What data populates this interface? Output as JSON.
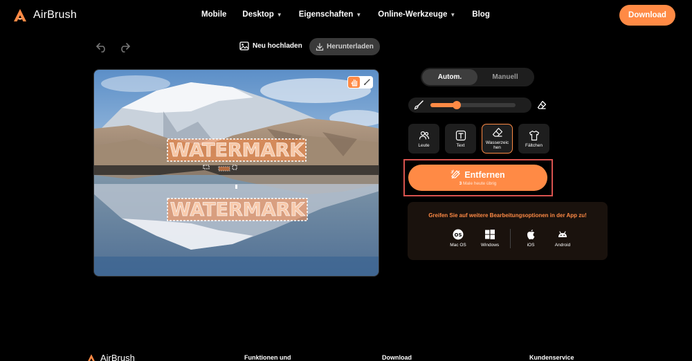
{
  "brand": {
    "name": "AirBrush",
    "accent": "#ff8a45"
  },
  "nav": {
    "items": [
      {
        "label": "Mobile",
        "dropdown": false
      },
      {
        "label": "Desktop",
        "dropdown": true
      },
      {
        "label": "Eigenschaften",
        "dropdown": true
      },
      {
        "label": "Online-Werkzeuge",
        "dropdown": true
      },
      {
        "label": "Blog",
        "dropdown": false
      }
    ],
    "download_label": "Download"
  },
  "toolbar": {
    "upload_label": "Neu hochladen",
    "export_label": "Herunterladen",
    "undo_icon": "undo-icon",
    "redo_icon": "redo-icon"
  },
  "canvas": {
    "watermark_top": "WATERMARK",
    "watermark_bottom": "WATERMARK",
    "active_tool": "hand-icon"
  },
  "panel": {
    "modes": [
      "Autom.",
      "Manuell"
    ],
    "active_mode": "Autom.",
    "brush_size_fraction": 0.31,
    "categories": [
      {
        "label": "Leute",
        "icon": "people-icon",
        "active": false
      },
      {
        "label": "Text",
        "icon": "text-icon",
        "active": false
      },
      {
        "label": "Wasserzeic hen",
        "icon": "eraser-icon",
        "active": true
      },
      {
        "label": "Fältchen",
        "icon": "shirt-icon",
        "active": false
      }
    ],
    "remove": {
      "label": "Entfernen",
      "count": "3",
      "sub": "Male heute übrig"
    },
    "app_promo": {
      "title": "Greifen Sie auf weitere Bearbeitungsoptionen in der App zu!",
      "platforms": [
        {
          "label": "Mac OS",
          "icon": "macos-icon"
        },
        {
          "label": "Windows",
          "icon": "windows-icon"
        },
        {
          "label": "iOS",
          "icon": "apple-icon"
        },
        {
          "label": "Android",
          "icon": "android-icon"
        }
      ]
    }
  },
  "footer": {
    "brand": "AirBrush",
    "columns": [
      "Funktionen und",
      "Download",
      "Kundenservice"
    ]
  }
}
